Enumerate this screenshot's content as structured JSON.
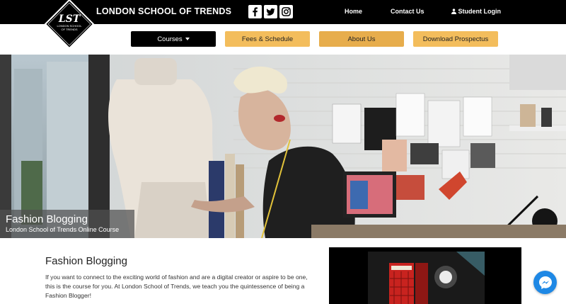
{
  "header": {
    "brand": "LONDON SCHOOL OF TRENDS",
    "logo_text": "LONDON SCHOOL OF TRENDS",
    "social": [
      {
        "icon": "facebook-icon"
      },
      {
        "icon": "twitter-icon"
      },
      {
        "icon": "instagram-icon"
      }
    ],
    "nav": {
      "home": "Home",
      "contact": "Contact Us",
      "login": "Student Login"
    }
  },
  "subnav": {
    "courses": "Courses",
    "fees": "Fees & Schedule",
    "about": "About Us",
    "prospectus": "Download Prospectus"
  },
  "hero": {
    "title": "Fashion Blogging",
    "subtitle": "London School of Trends Online Course"
  },
  "content": {
    "title": "Fashion Blogging",
    "text": "If you want to connect to the exciting world of fashion and are a digital creator or aspire to be one, this is the course for you. At London School of Trends, we teach you the quintessence of being a Fashion Blogger!"
  },
  "colors": {
    "topbar": "#000000",
    "gold": "#f3bd5c",
    "gold_dark": "#e7ad4c",
    "messenger": "#1e88e5"
  }
}
